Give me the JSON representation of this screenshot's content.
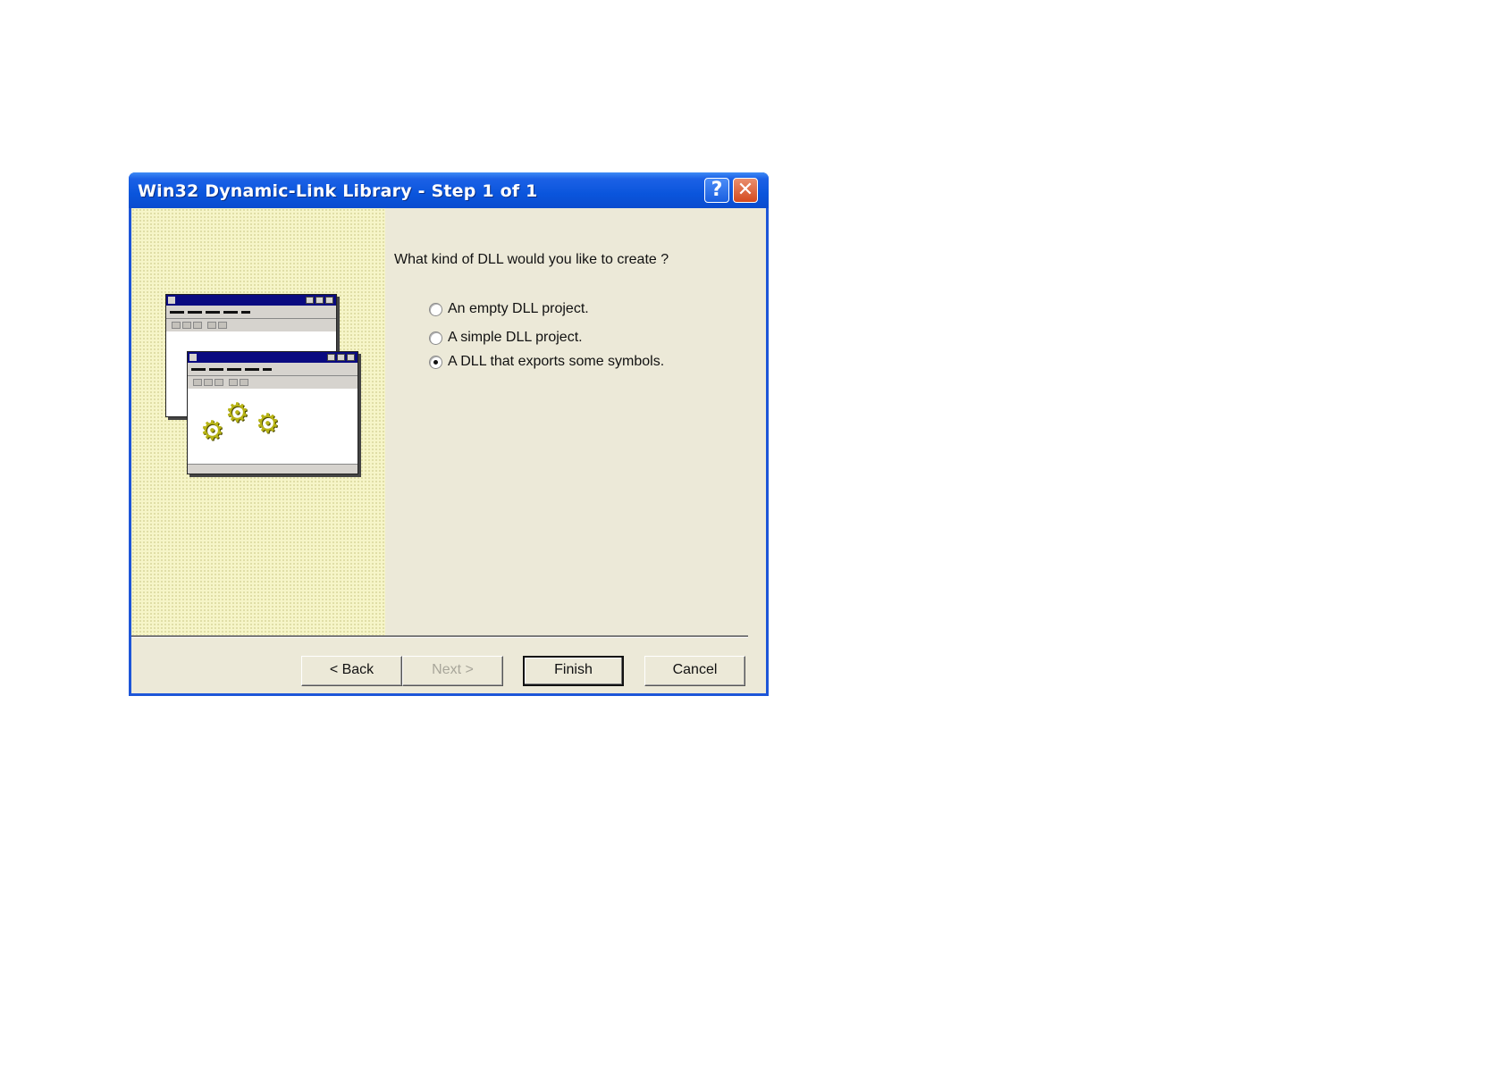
{
  "window": {
    "title": "Win32 Dynamic-Link Library - Step 1 of 1",
    "help_icon": "?",
    "close_icon": "✕"
  },
  "wizard": {
    "prompt": "What kind of DLL would you like to create ?",
    "options": [
      {
        "label": "An empty DLL project.",
        "checked": false
      },
      {
        "label": "A simple DLL project.",
        "checked": false
      },
      {
        "label": "A DLL that exports some symbols.",
        "checked": true
      }
    ]
  },
  "buttons": {
    "back": "< Back",
    "next": "Next >",
    "finish": "Finish",
    "cancel": "Cancel"
  },
  "illustration": {
    "icon": "windows-with-gears-icon",
    "gear_glyph": "⚙"
  },
  "colors": {
    "titlebar": "#0a55dc",
    "dialog_face": "#ece9d8",
    "close_button": "#d44a1e"
  }
}
